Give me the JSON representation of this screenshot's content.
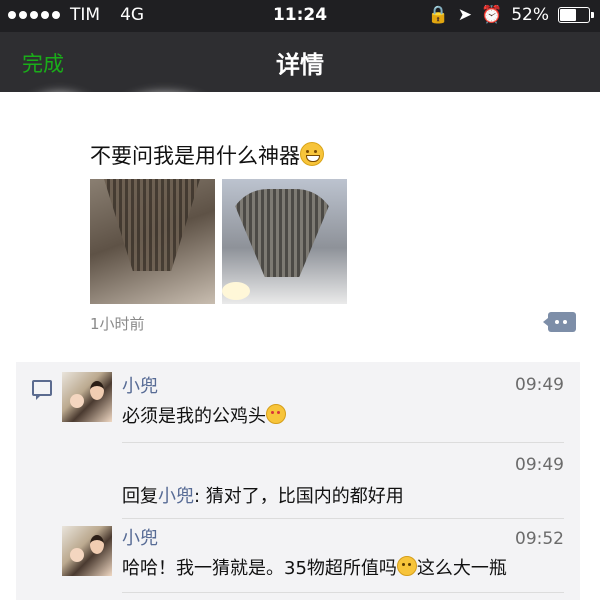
{
  "status_bar": {
    "carrier": "TIM",
    "network": "4G",
    "time": "11:24",
    "battery": "52%",
    "battery_level": 0.52
  },
  "nav": {
    "done_label": "完成",
    "title": "详情"
  },
  "post": {
    "text": "不要问我是用什么神器",
    "time_ago": "1小时前",
    "photos": [
      "photo-1",
      "photo-2"
    ]
  },
  "comments": [
    {
      "name": "小兜",
      "time": "09:49",
      "text": "必须是我的公鸡头"
    },
    {
      "time": "09:49",
      "reply_word": "回复",
      "reply_to": "小兜",
      "text": ": 猜对了，比国内的都好用"
    },
    {
      "name": "小兜",
      "time": "09:52",
      "text_a": "哈哈！我一猜就是。35物超所值吗",
      "text_b": "这么大一瓶"
    }
  ],
  "colors": {
    "accent_green": "#1aad19",
    "link_blue": "#576b95",
    "nav_bg": "#2e2e31"
  }
}
